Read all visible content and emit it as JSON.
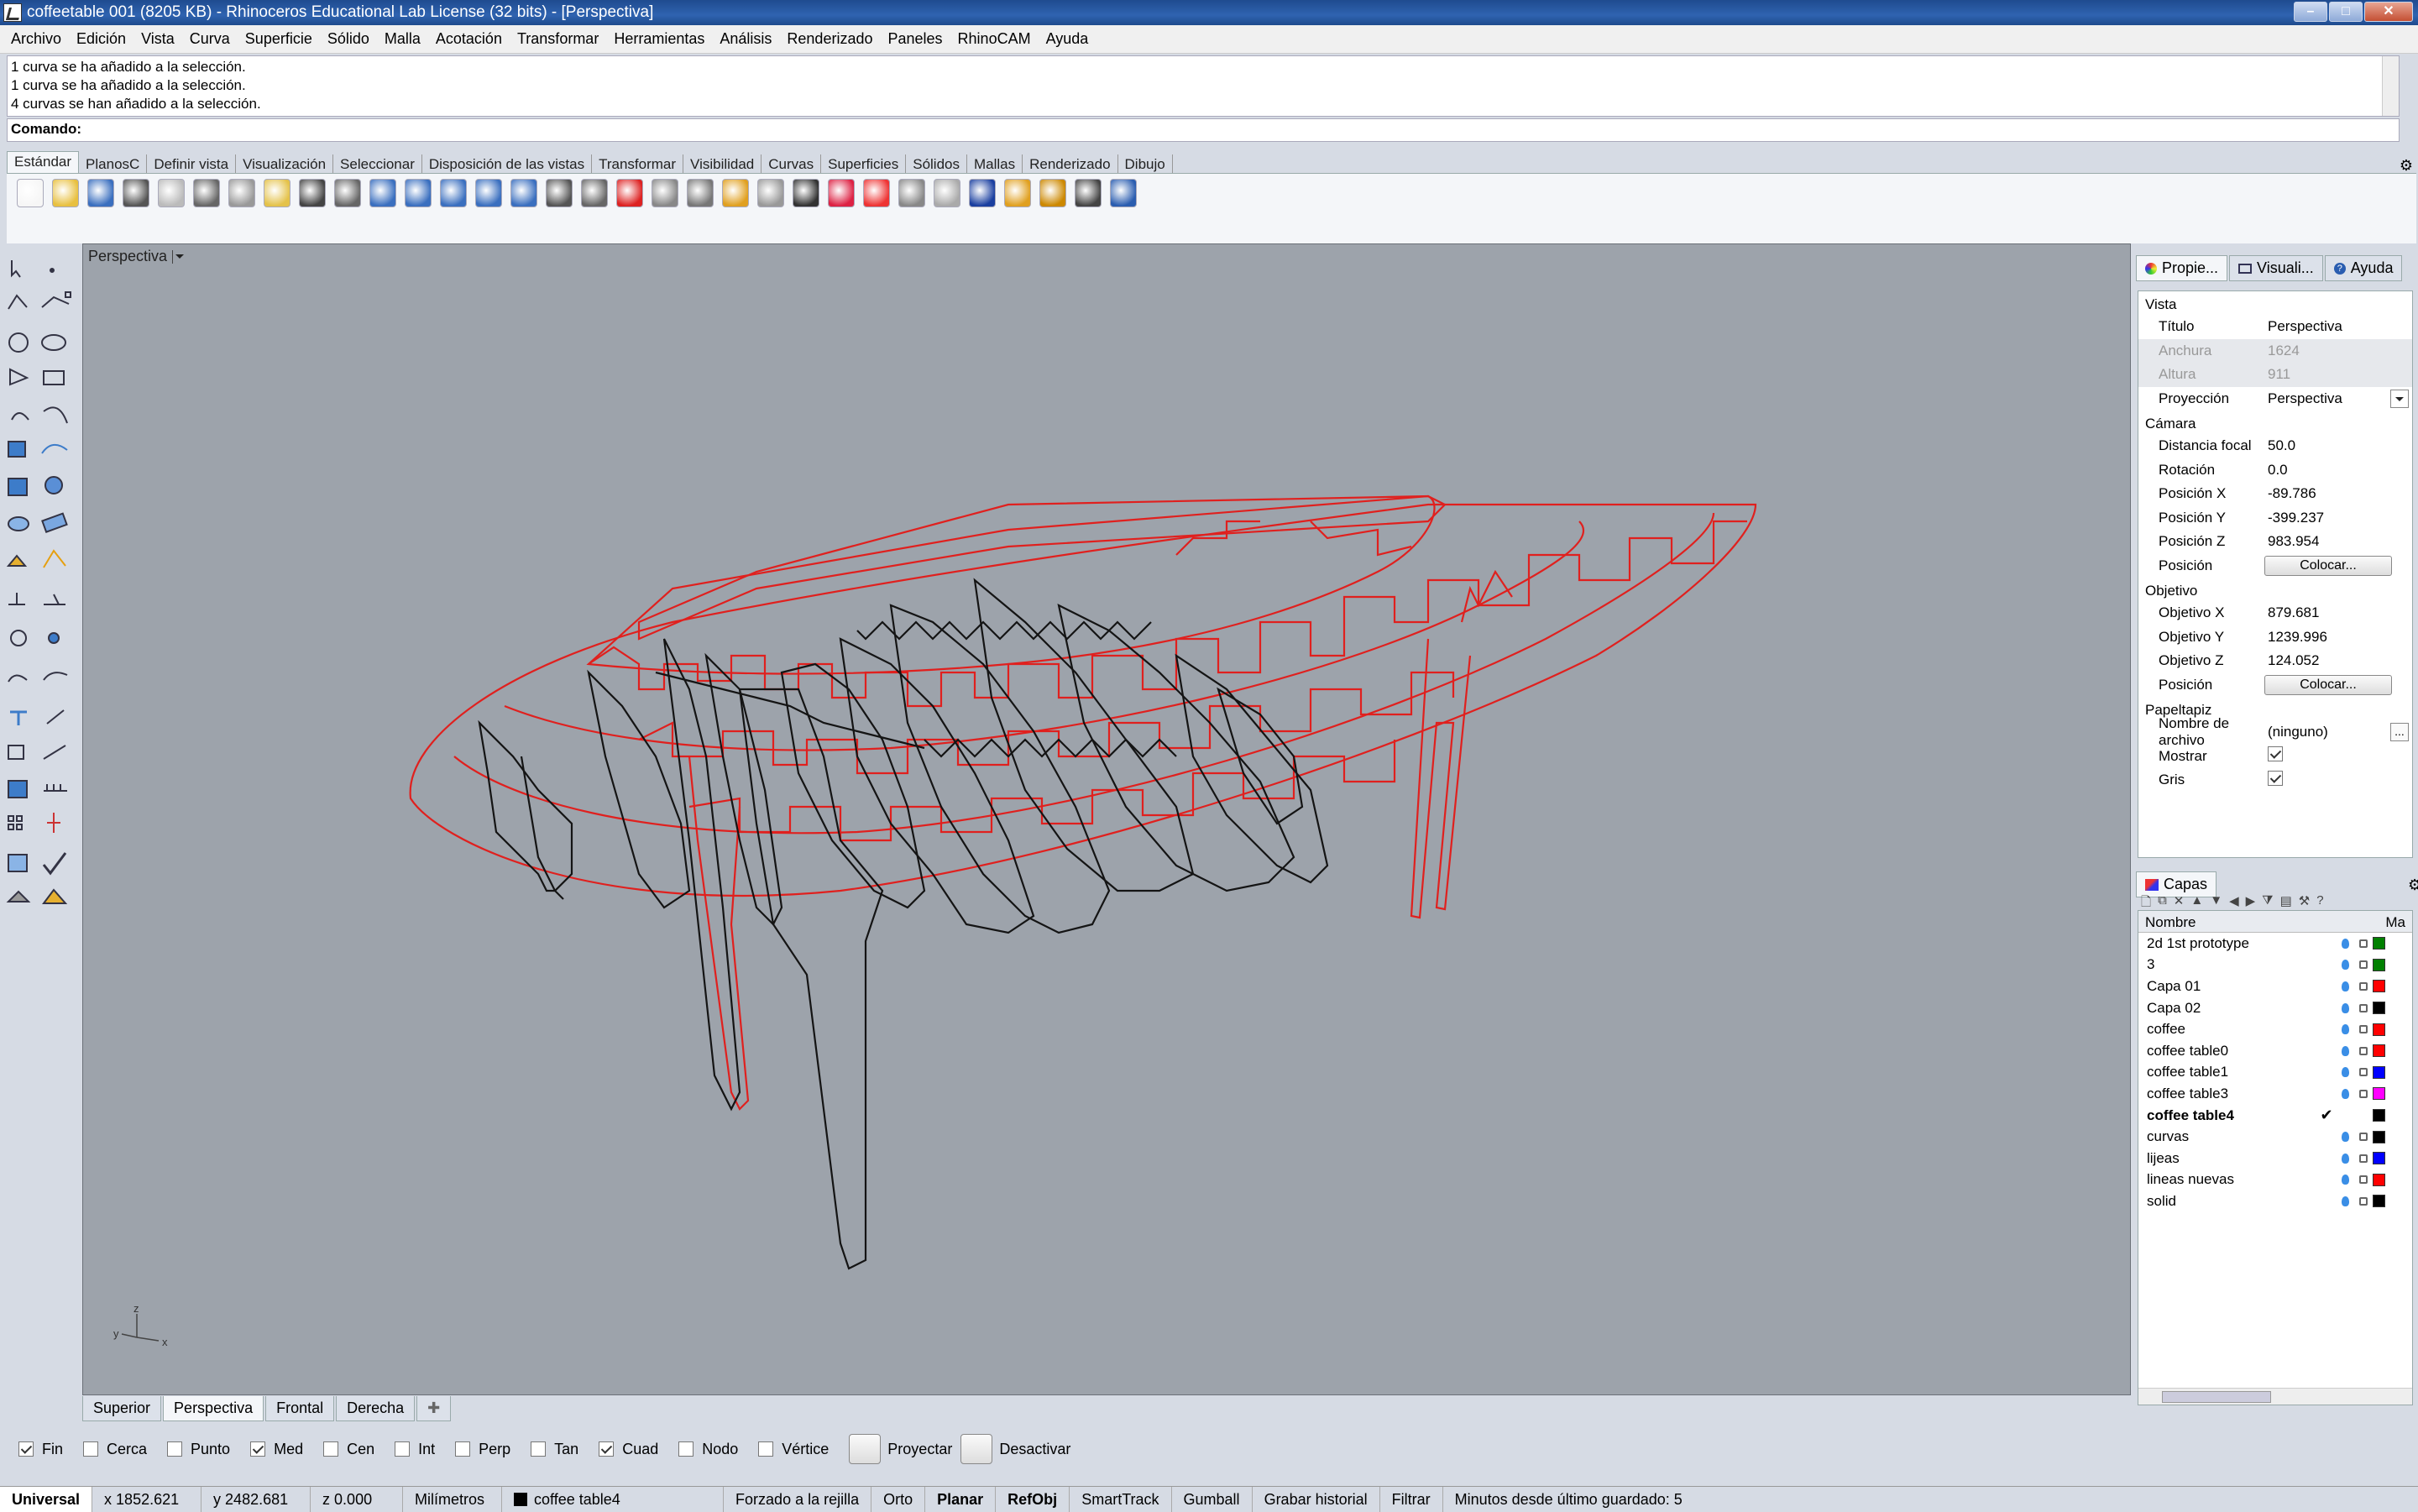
{
  "window": {
    "title": "coffeetable 001 (8205 KB) - Rhinoceros Educational Lab License (32 bits) - [Perspectiva]"
  },
  "menu": [
    "Archivo",
    "Edición",
    "Vista",
    "Curva",
    "Superficie",
    "Sólido",
    "Malla",
    "Acotación",
    "Transformar",
    "Herramientas",
    "Análisis",
    "Renderizado",
    "Paneles",
    "RhinoCAM",
    "Ayuda"
  ],
  "command": {
    "history": [
      "1 curva se ha añadido a la selección.",
      "1 curva se ha añadido a la selección.",
      "4 curvas se han añadido a la selección."
    ],
    "prompt": "Comando:"
  },
  "toolbar_tabs": [
    "Estándar",
    "PlanosC",
    "Definir vista",
    "Visualización",
    "Seleccionar",
    "Disposición de las vistas",
    "Transformar",
    "Visibilidad",
    "Curvas",
    "Superficies",
    "Sólidos",
    "Mallas",
    "Renderizado",
    "Dibujo"
  ],
  "toolbar_icons": [
    "new-file-icon",
    "open-icon",
    "save-icon",
    "print-icon",
    "import-icon",
    "cut-icon",
    "copy-icon",
    "paste-icon",
    "undo-icon",
    "pan-icon",
    "move-view-icon",
    "zoom-icon",
    "zoom-window-icon",
    "zoom-extents-icon",
    "zoom-selected-icon",
    "rotate-view-icon",
    "four-views-icon",
    "car-icon",
    "toggle-icon",
    "object-snap-icon",
    "points-icon",
    "light-icon",
    "lock-icon",
    "layer-icon",
    "color-wheel-icon",
    "shade-icon",
    "render-sphere-icon",
    "render-blue-icon",
    "flag-icon",
    "gears-icon",
    "dimension-icon",
    "help-icon"
  ],
  "viewport": {
    "name": "Perspectiva",
    "axes": {
      "z": "z",
      "y": "y",
      "x": "x"
    }
  },
  "view_tabs": [
    "Superior",
    "Perspectiva",
    "Frontal",
    "Derecha"
  ],
  "osnap": [
    {
      "label": "Fin",
      "checked": true
    },
    {
      "label": "Cerca",
      "checked": false
    },
    {
      "label": "Punto",
      "checked": false
    },
    {
      "label": "Med",
      "checked": true
    },
    {
      "label": "Cen",
      "checked": false
    },
    {
      "label": "Int",
      "checked": false
    },
    {
      "label": "Perp",
      "checked": false
    },
    {
      "label": "Tan",
      "checked": false
    },
    {
      "label": "Cuad",
      "checked": true
    },
    {
      "label": "Nodo",
      "checked": false
    },
    {
      "label": "Vértice",
      "checked": false
    }
  ],
  "osnap_buttons": [
    "Proyectar",
    "Desactivar"
  ],
  "status": {
    "cplane": "Universal",
    "x": "x 1852.621",
    "y": "y 2482.681",
    "z": "z 0.000",
    "units": "Milímetros",
    "layer": "coffee table4",
    "grid_snap": "Forzado a la rejilla",
    "ortho": "Orto",
    "planar": "Planar",
    "osnap": "RefObj",
    "smarttrack": "SmartTrack",
    "gumball": "Gumball",
    "history": "Grabar historial",
    "filter": "Filtrar",
    "saved": "Minutos desde último guardado: 5"
  },
  "panel_tabs": [
    "Propie...",
    "Visuali...",
    "Ayuda"
  ],
  "properties": {
    "vista": {
      "section": "Vista",
      "titulo_label": "Título",
      "titulo": "Perspectiva",
      "anchura_label": "Anchura",
      "anchura": "1624",
      "altura_label": "Altura",
      "altura": "911",
      "proyeccion_label": "Proyección",
      "proyeccion": "Perspectiva"
    },
    "camara": {
      "section": "Cámara",
      "focal_label": "Distancia focal",
      "focal": "50.0",
      "rot_label": "Rotación",
      "rot": "0.0",
      "px_label": "Posición X",
      "px": "-89.786",
      "py_label": "Posición Y",
      "py": "-399.237",
      "pz_label": "Posición Z",
      "pz": "983.954",
      "pos_label": "Posición",
      "btn": "Colocar..."
    },
    "objetivo": {
      "section": "Objetivo",
      "ox_label": "Objetivo X",
      "ox": "879.681",
      "oy_label": "Objetivo Y",
      "oy": "1239.996",
      "oz_label": "Objetivo Z",
      "oz": "124.052",
      "pos_label": "Posición",
      "btn": "Colocar..."
    },
    "papel": {
      "section": "Papeltapiz",
      "file_label": "Nombre de archivo",
      "file": "(ninguno)",
      "mostrar_label": "Mostrar",
      "mostrar": true,
      "gris_label": "Gris",
      "gris": true
    }
  },
  "layers": {
    "tab": "Capas",
    "header": "Nombre",
    "header_extra": "Ma",
    "items": [
      {
        "name": "2d 1st prototype",
        "color": "#008000"
      },
      {
        "name": "3",
        "color": "#008000"
      },
      {
        "name": "Capa 01",
        "color": "#ff0000"
      },
      {
        "name": "Capa 02",
        "color": "#000000"
      },
      {
        "name": "coffee",
        "color": "#ff0000"
      },
      {
        "name": "coffee table0",
        "color": "#ff0000"
      },
      {
        "name": "coffee table1",
        "color": "#0000ff"
      },
      {
        "name": "coffee table3",
        "color": "#ff00ff"
      },
      {
        "name": "coffee table4",
        "color": "#000000",
        "current": true
      },
      {
        "name": "curvas",
        "color": "#000000"
      },
      {
        "name": "lijeas",
        "color": "#0000ff"
      },
      {
        "name": "lineas nuevas",
        "color": "#ff0000"
      },
      {
        "name": "solid",
        "color": "#000000"
      }
    ]
  }
}
